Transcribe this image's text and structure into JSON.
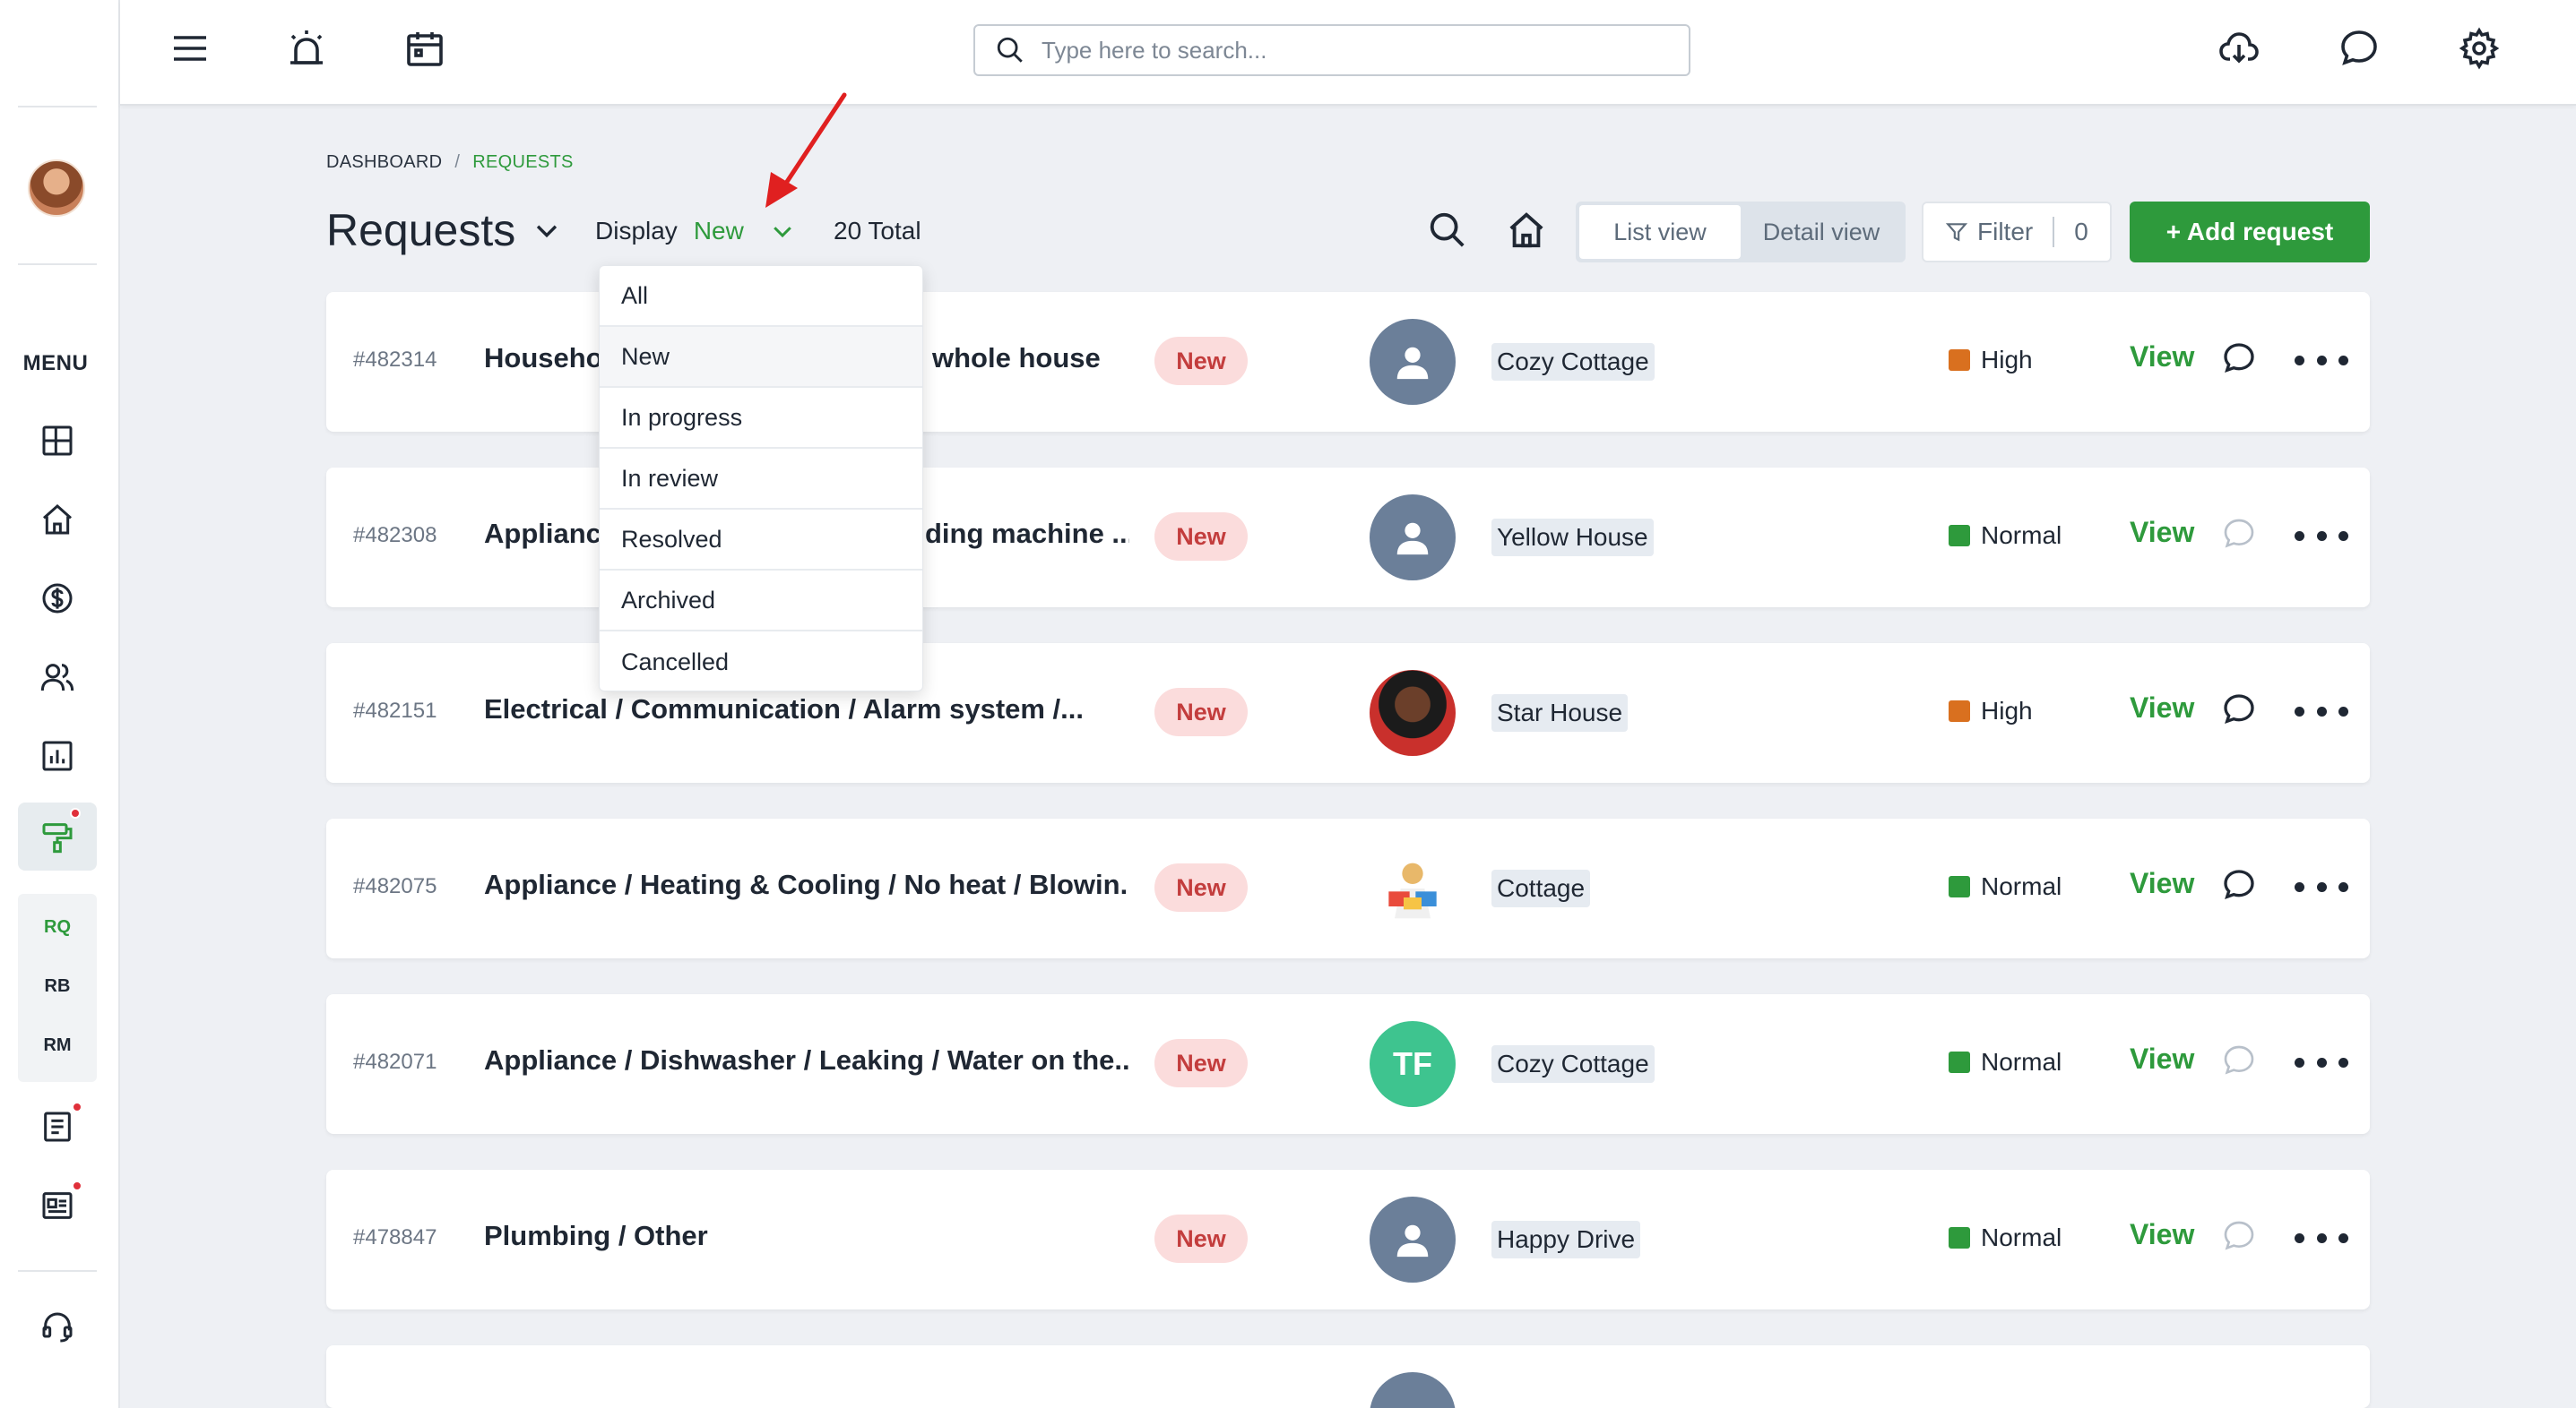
{
  "topbar": {
    "search_placeholder": "Type here to search..."
  },
  "sidebar": {
    "menu_label": "MENU",
    "sub_items": [
      {
        "label": "RQ"
      },
      {
        "label": "RB"
      },
      {
        "label": "RM"
      }
    ]
  },
  "breadcrumb": {
    "root": "DASHBOARD",
    "separator": "/",
    "current": "REQUESTS"
  },
  "header": {
    "title": "Requests",
    "display_label": "Display",
    "display_value": "New",
    "total": "20 Total",
    "list_view": "List view",
    "detail_view": "Detail view",
    "filter_label": "Filter",
    "filter_count": "0",
    "add_request": "+ Add request"
  },
  "dropdown": {
    "options": [
      "All",
      "New",
      "In progress",
      "In review",
      "Resolved",
      "Archived",
      "Cancelled"
    ],
    "highlighted": "New"
  },
  "rows": [
    {
      "id": "#482314",
      "title": "Househo",
      "title_tail": "whole house",
      "status": "New",
      "avatar": "generic",
      "property": "Cozy Cottage",
      "priority": "High",
      "priority_color": "#d9701f",
      "view": "View",
      "comments": true
    },
    {
      "id": "#482308",
      "title": "Appliance",
      "title_tail": "ding machine ...",
      "status": "New",
      "avatar": "generic",
      "property": "Yellow House",
      "priority": "Normal",
      "priority_color": "#2e9a3c",
      "view": "View",
      "comments": false
    },
    {
      "id": "#482151",
      "title": "Electrical / Communication / Alarm system /...",
      "status": "New",
      "avatar": "photo",
      "property": "Star House",
      "priority": "High",
      "priority_color": "#d9701f",
      "view": "View",
      "comments": true
    },
    {
      "id": "#482075",
      "title": "Appliance / Heating & Cooling / No heat / Blowin...",
      "status": "New",
      "avatar": "photo",
      "property": "Cottage",
      "priority": "Normal",
      "priority_color": "#2e9a3c",
      "view": "View",
      "comments": true
    },
    {
      "id": "#482071",
      "title": "Appliance / Dishwasher / Leaking / Water on the...",
      "status": "New",
      "avatar": "TF",
      "property": "Cozy Cottage",
      "priority": "Normal",
      "priority_color": "#2e9a3c",
      "view": "View",
      "comments": false
    },
    {
      "id": "#478847",
      "title": "Plumbing / Other",
      "status": "New",
      "avatar": "generic",
      "property": "Happy Drive",
      "priority": "Normal",
      "priority_color": "#2e9a3c",
      "view": "View",
      "comments": false
    }
  ],
  "colors": {
    "accent": "#2e9a3c",
    "badge_bg": "#fbdcdc",
    "badge_text": "#c33d3d",
    "high": "#d9701f",
    "normal": "#2e9a3c"
  }
}
